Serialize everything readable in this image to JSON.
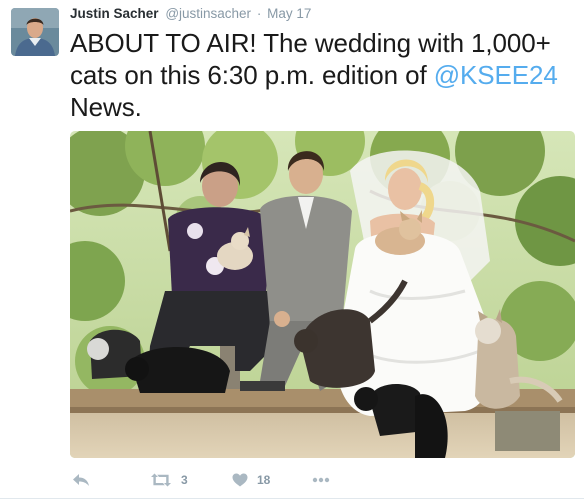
{
  "tweet": {
    "author": {
      "full_name": "Justin Sacher",
      "username": "@justinsacher",
      "avatar_icon": "profile-photo"
    },
    "separator": "·",
    "timestamp": "May 17",
    "text_before_mention": "ABOUT TO AIR!  The wedding with 1,000+ cats on this 6:30 p.m. edition of ",
    "mention": "@KSEE24",
    "text_after_mention": " News.",
    "media": {
      "type": "photo",
      "subject": "wedding photo with cats"
    },
    "actions": {
      "reply_icon": "reply-icon",
      "retweet_icon": "retweet-icon",
      "retweet_count": "3",
      "like_icon": "heart-icon",
      "like_count": "18",
      "more_icon": "more-dots-icon"
    }
  },
  "colors": {
    "link": "#55acee",
    "muted": "#8899a6",
    "icon": "#aab8c2",
    "text": "#1a1a1a"
  }
}
